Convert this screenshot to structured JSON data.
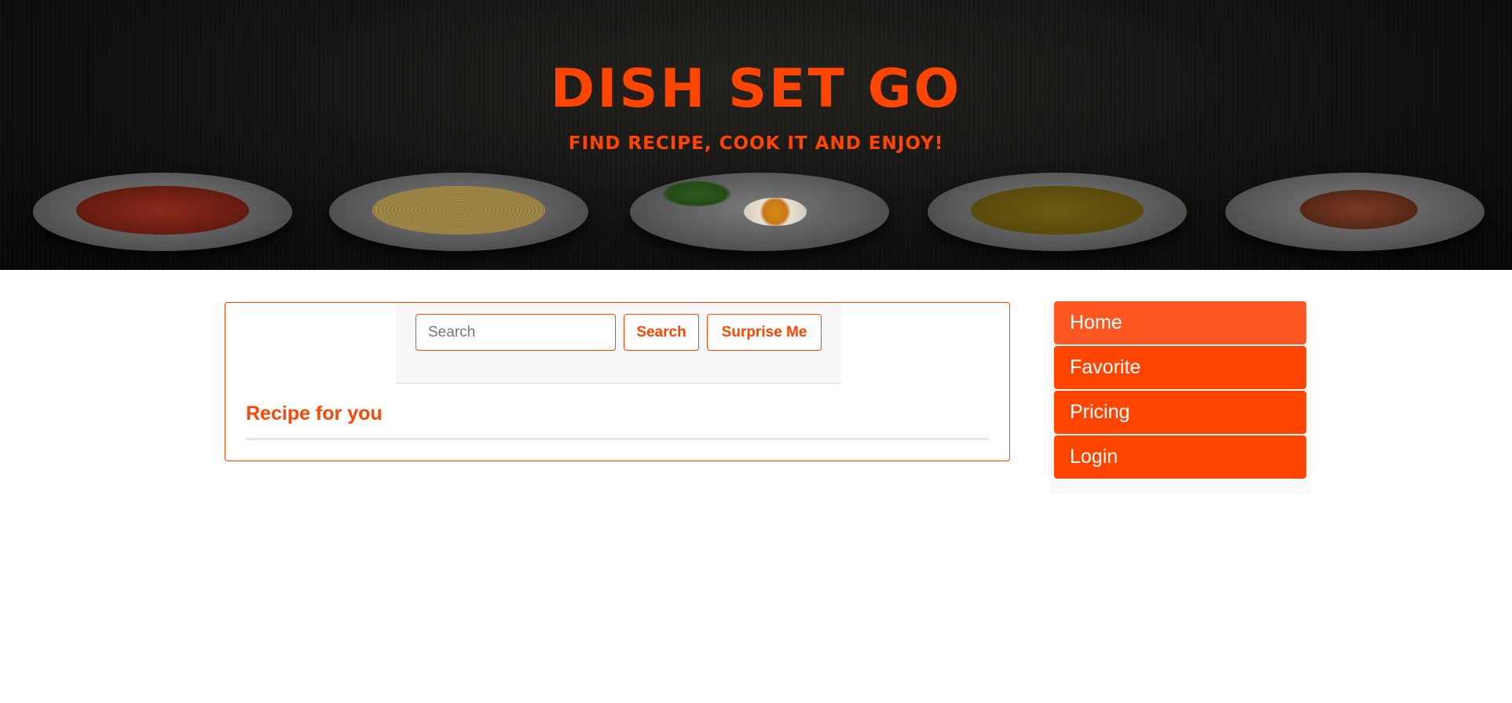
{
  "hero": {
    "title": "Dish Set Go",
    "tagline": "Find recipe, cook it and enjoy!",
    "plates": [
      "pasta-soup-plate",
      "spaghetti-plate",
      "fried-egg-plate",
      "pumpkin-soup-plate",
      "grilled-meat-plate"
    ]
  },
  "search": {
    "placeholder": "Search",
    "value": "",
    "search_button": "Search",
    "surprise_button": "Surprise Me"
  },
  "main": {
    "section_heading": "Recipe for you"
  },
  "sidebar": {
    "items": [
      {
        "label": "Home",
        "active": true
      },
      {
        "label": "Favorite",
        "active": false
      },
      {
        "label": "Pricing",
        "active": false
      },
      {
        "label": "Login",
        "active": false
      }
    ]
  },
  "colors": {
    "accent": "#ff4500",
    "accent_active": "#ff5722",
    "hero_bg": "#121110"
  }
}
